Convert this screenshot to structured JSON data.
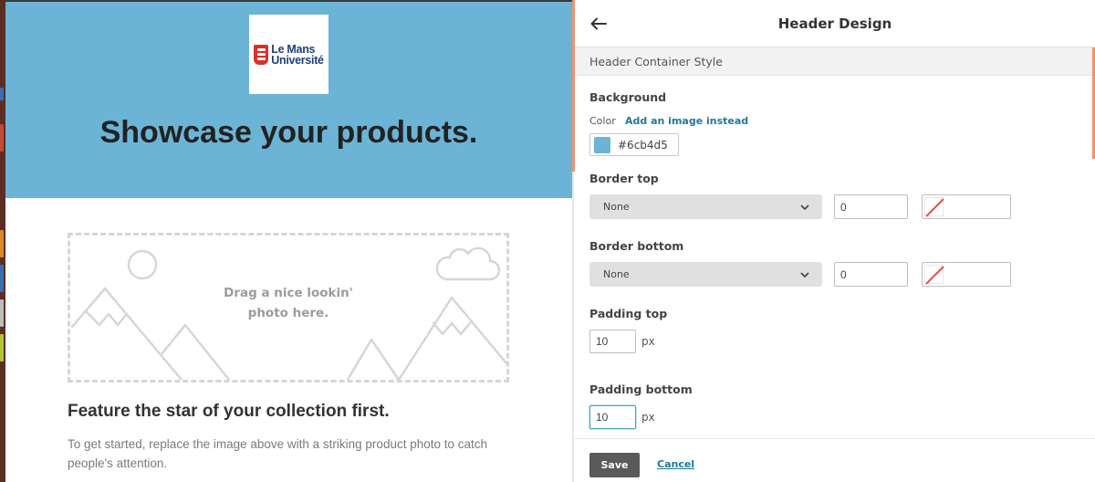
{
  "colors": {
    "hero_background": "#6cb4d5",
    "accent": "#f0926f",
    "link": "#1f7a98",
    "logo_red": "#d9302a",
    "logo_blue": "#1f3f7a"
  },
  "preview": {
    "logo": {
      "line1": "Le Mans",
      "line2": "Université"
    },
    "hero_title": "Showcase your products.",
    "photo_placeholder": {
      "line1": "Drag a nice lookin'",
      "line2": "photo here."
    },
    "feature_title": "Feature the star of your collection first.",
    "feature_body": "To get started, replace the image above with a striking product photo to catch people's attention."
  },
  "panel": {
    "back_icon": "arrow-left-icon",
    "title": "Header Design",
    "section_title": "Header Container Style",
    "background": {
      "label": "Background",
      "mode_label": "Color",
      "alt_link": "Add an image instead",
      "hex": "#6cb4d5"
    },
    "border_top": {
      "label": "Border top",
      "style": "None",
      "width": "0",
      "color_icon": "no-color-swatch-icon"
    },
    "border_bottom": {
      "label": "Border bottom",
      "style": "None",
      "width": "0",
      "color_icon": "no-color-swatch-icon"
    },
    "padding_top": {
      "label": "Padding top",
      "value": "10",
      "unit": "px"
    },
    "padding_bottom": {
      "label": "Padding bottom",
      "value": "10",
      "unit": "px"
    },
    "footer": {
      "save_label": "Save",
      "cancel_label": "Cancel"
    }
  }
}
